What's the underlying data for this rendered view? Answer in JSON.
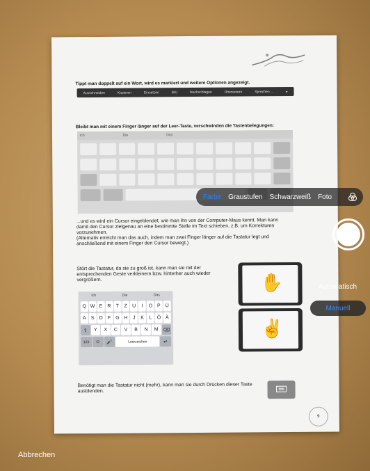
{
  "document": {
    "line1": "Tippt man doppelt auf ein Wort, wird es markiert und weitere Optionen angezeigt.",
    "context_menu": [
      "Ausschneiden",
      "Kopieren",
      "Einsetzen",
      "BIU",
      "Nachschlagen",
      "Übersetzen",
      "Sprechen ..."
    ],
    "line2": "Bleibt man mit einem Finger länger auf der Leer-Taste, verschwinden die Tastenbelegungen:",
    "kb_suggestions": [
      "Ich",
      "Die",
      "Das"
    ],
    "para3_1": "...und es wird ein Cursor eingeblendet, wie man ihn von der Computer-Maus kennt. Man kann",
    "para3_2": "damit den Cursor zielgenau an eine bestimmte Stelle im Text schieben, z.B. um Korrekturen",
    "para3_3": "vorzunehmen.",
    "para3_4": "(Alternativ erreicht man das auch, indem man zwei Finger länger auf die Tastatur legt und",
    "para3_5": "anschließend mit einem Finger den Cursor bewegt.)",
    "para4_1": "Stört die Tastatur, da sie zu groß ist, kann man sie mit der",
    "para4_2": "entsprechenden Geste verkleinern bzw. hinterher auch wieder",
    "para4_3": "vergrößern.",
    "small_kb": {
      "suggestions": [
        "Ich",
        "Die",
        "Das"
      ],
      "row1": [
        "Q",
        "W",
        "E",
        "R",
        "T",
        "Z",
        "U",
        "I",
        "O",
        "P",
        "Ü"
      ],
      "row2": [
        "A",
        "S",
        "D",
        "F",
        "G",
        "H",
        "J",
        "K",
        "L",
        "Ö",
        "Ä"
      ],
      "row3": [
        "Y",
        "X",
        "C",
        "V",
        "B",
        "N",
        "M"
      ],
      "space": "Leerzeichen",
      "num": "123"
    },
    "para5_1": "Benötigt man die Tastatur nicht (mehr), kann man sie durch Drücken dieser Taste",
    "para5_2": "ausblenden.",
    "page_number": "9"
  },
  "filters": {
    "options": [
      "Farbe",
      "Graustufen",
      "Schwarzweiß",
      "Foto"
    ],
    "active": "Farbe"
  },
  "modes": {
    "auto": "Automatisch",
    "manual": "Manuell"
  },
  "cancel_label": "Abbrechen",
  "colors": {
    "accent": "#2f7ff7"
  }
}
